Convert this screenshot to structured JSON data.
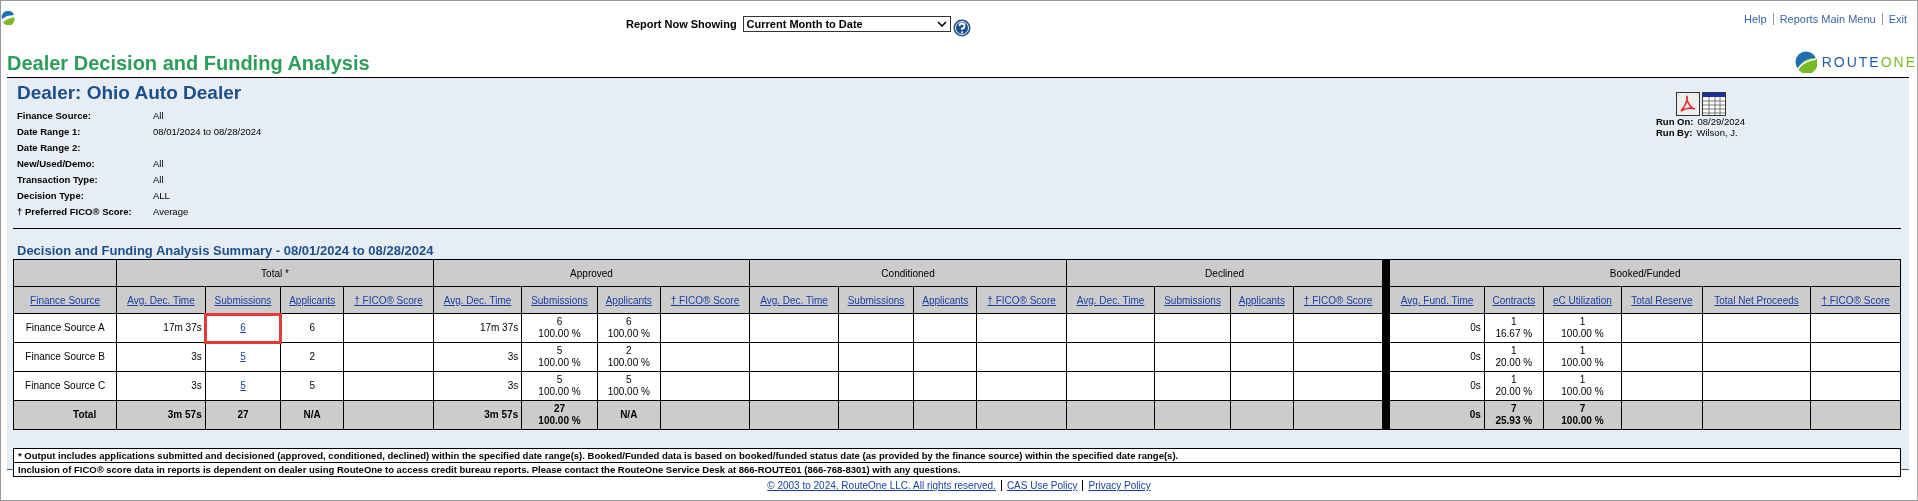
{
  "top_bar": {
    "report_label": "Report Now Showing",
    "report_select": {
      "value": "Current Month to Date"
    },
    "links": [
      "Help",
      "Reports Main Menu",
      "Exit"
    ]
  },
  "page_title": "Dealer Decision and Funding Analysis",
  "logo": {
    "part_1": "ROUTE",
    "part_2": "ONE"
  },
  "dealer": {
    "heading": "Dealer: Ohio Auto Dealer",
    "filters": [
      {
        "label": "Finance Source:",
        "value": "All"
      },
      {
        "label": "Date Range 1:",
        "value": "08/01/2024 to 08/28/2024"
      },
      {
        "label": "Date Range 2:"
      },
      {
        "label": "New/Used/Demo:",
        "value": "All"
      },
      {
        "label": "Transaction Type:",
        "value": "All"
      },
      {
        "label": "Decision Type:",
        "value": "ALL"
      },
      {
        "label": "† Preferred FICO® Score:",
        "value": "Average"
      }
    ],
    "run_info": [
      {
        "label": "Run On:",
        "value": "08/29/2024"
      },
      {
        "label": "Run By:",
        "value": "Wilson, J."
      }
    ]
  },
  "summary": {
    "title": "Decision and Funding Analysis Summary - 08/01/2024 to 08/28/2024",
    "first_column": "Finance Source",
    "groups": [
      {
        "name": "Total *",
        "columns": [
          "Avg. Dec. Time",
          "Submissions",
          "Applicants",
          "† FICO® Score"
        ]
      },
      {
        "name": "Approved",
        "columns": [
          "Avg. Dec. Time",
          "Submissions",
          "Applicants",
          "† FICO® Score"
        ]
      },
      {
        "name": "Conditioned",
        "columns": [
          "Avg. Dec. Time",
          "Submissions",
          "Applicants",
          "† FICO® Score"
        ]
      },
      {
        "name": "Declined",
        "columns": [
          "Avg. Dec. Time",
          "Submissions",
          "Applicants",
          "† FICO® Score"
        ]
      },
      {
        "name": "Booked/Funded",
        "columns": [
          "Avg. Fund. Time",
          "Contracts",
          "eC Utilization",
          "Total Reserve",
          "Total Net Proceeds",
          "† FICO® Score"
        ]
      }
    ],
    "rows": [
      {
        "name": "Finance Source A",
        "total": false,
        "cells": [
          {
            "value": "17m 37s",
            "kind": "time"
          },
          {
            "value": "6",
            "link": true,
            "highlighted": true
          },
          {
            "value": "6"
          },
          null,
          {
            "value": "17m 37s",
            "kind": "time"
          },
          {
            "value": "6",
            "percent": "100.00 %"
          },
          {
            "value": "6",
            "percent": "100.00 %"
          },
          null,
          null,
          null,
          null,
          null,
          null,
          null,
          null,
          null,
          {
            "value": "0s",
            "kind": "time"
          },
          {
            "value": "1",
            "percent": "16.67 %"
          },
          {
            "value": "1",
            "percent": "100.00 %"
          },
          null,
          null,
          null
        ]
      },
      {
        "name": "Finance Source B",
        "total": false,
        "cells": [
          {
            "value": "3s",
            "kind": "time"
          },
          {
            "value": "5",
            "link": true,
            "highlighted": false
          },
          {
            "value": "2"
          },
          null,
          {
            "value": "3s",
            "kind": "time"
          },
          {
            "value": "5",
            "percent": "100.00 %"
          },
          {
            "value": "2",
            "percent": "100.00 %"
          },
          null,
          null,
          null,
          null,
          null,
          null,
          null,
          null,
          null,
          {
            "value": "0s",
            "kind": "time"
          },
          {
            "value": "1",
            "percent": "20.00 %"
          },
          {
            "value": "1",
            "percent": "100.00 %"
          },
          null,
          null,
          null
        ]
      },
      {
        "name": "Finance Source C",
        "total": false,
        "cells": [
          {
            "value": "3s",
            "kind": "time"
          },
          {
            "value": "5",
            "link": true,
            "highlighted": false
          },
          {
            "value": "5"
          },
          null,
          {
            "value": "3s",
            "kind": "time"
          },
          {
            "value": "5",
            "percent": "100.00 %"
          },
          {
            "value": "5",
            "percent": "100.00 %"
          },
          null,
          null,
          null,
          null,
          null,
          null,
          null,
          null,
          null,
          {
            "value": "0s",
            "kind": "time"
          },
          {
            "value": "1",
            "percent": "20.00 %"
          },
          {
            "value": "1",
            "percent": "100.00 %"
          },
          null,
          null,
          null
        ]
      },
      {
        "name": "Total",
        "total": true,
        "cells": [
          {
            "value": "3m 57s",
            "kind": "time"
          },
          {
            "value": "27"
          },
          {
            "value": "N/A"
          },
          null,
          {
            "value": "3m 57s",
            "kind": "time"
          },
          {
            "value": "27",
            "percent": "100.00 %"
          },
          {
            "value": "N/A"
          },
          null,
          null,
          null,
          null,
          null,
          null,
          null,
          null,
          null,
          {
            "value": "0s",
            "kind": "time"
          },
          {
            "value": "7",
            "percent": "25.93 %"
          },
          {
            "value": "7",
            "percent": "100.00 %"
          },
          null,
          null,
          null
        ]
      }
    ]
  },
  "footnotes": [
    "* Output includes applications submitted and decisioned (approved, conditioned, declined) within the specified date range(s). Booked/Funded data is based on booked/funded status date (as provided by the finance source) within the specified date range(s).",
    "Inclusion of FICO® score data in reports is dependent on dealer using RouteOne to access credit bureau reports. Please contact the RouteOne Service Desk at 866-ROUTE01 (866-768-8301) with any questions."
  ],
  "footer_links": [
    "© 2003 to 2024, RouteOne LLC. All rights reserved.",
    "CAS Use Policy",
    "Privacy Policy"
  ]
}
